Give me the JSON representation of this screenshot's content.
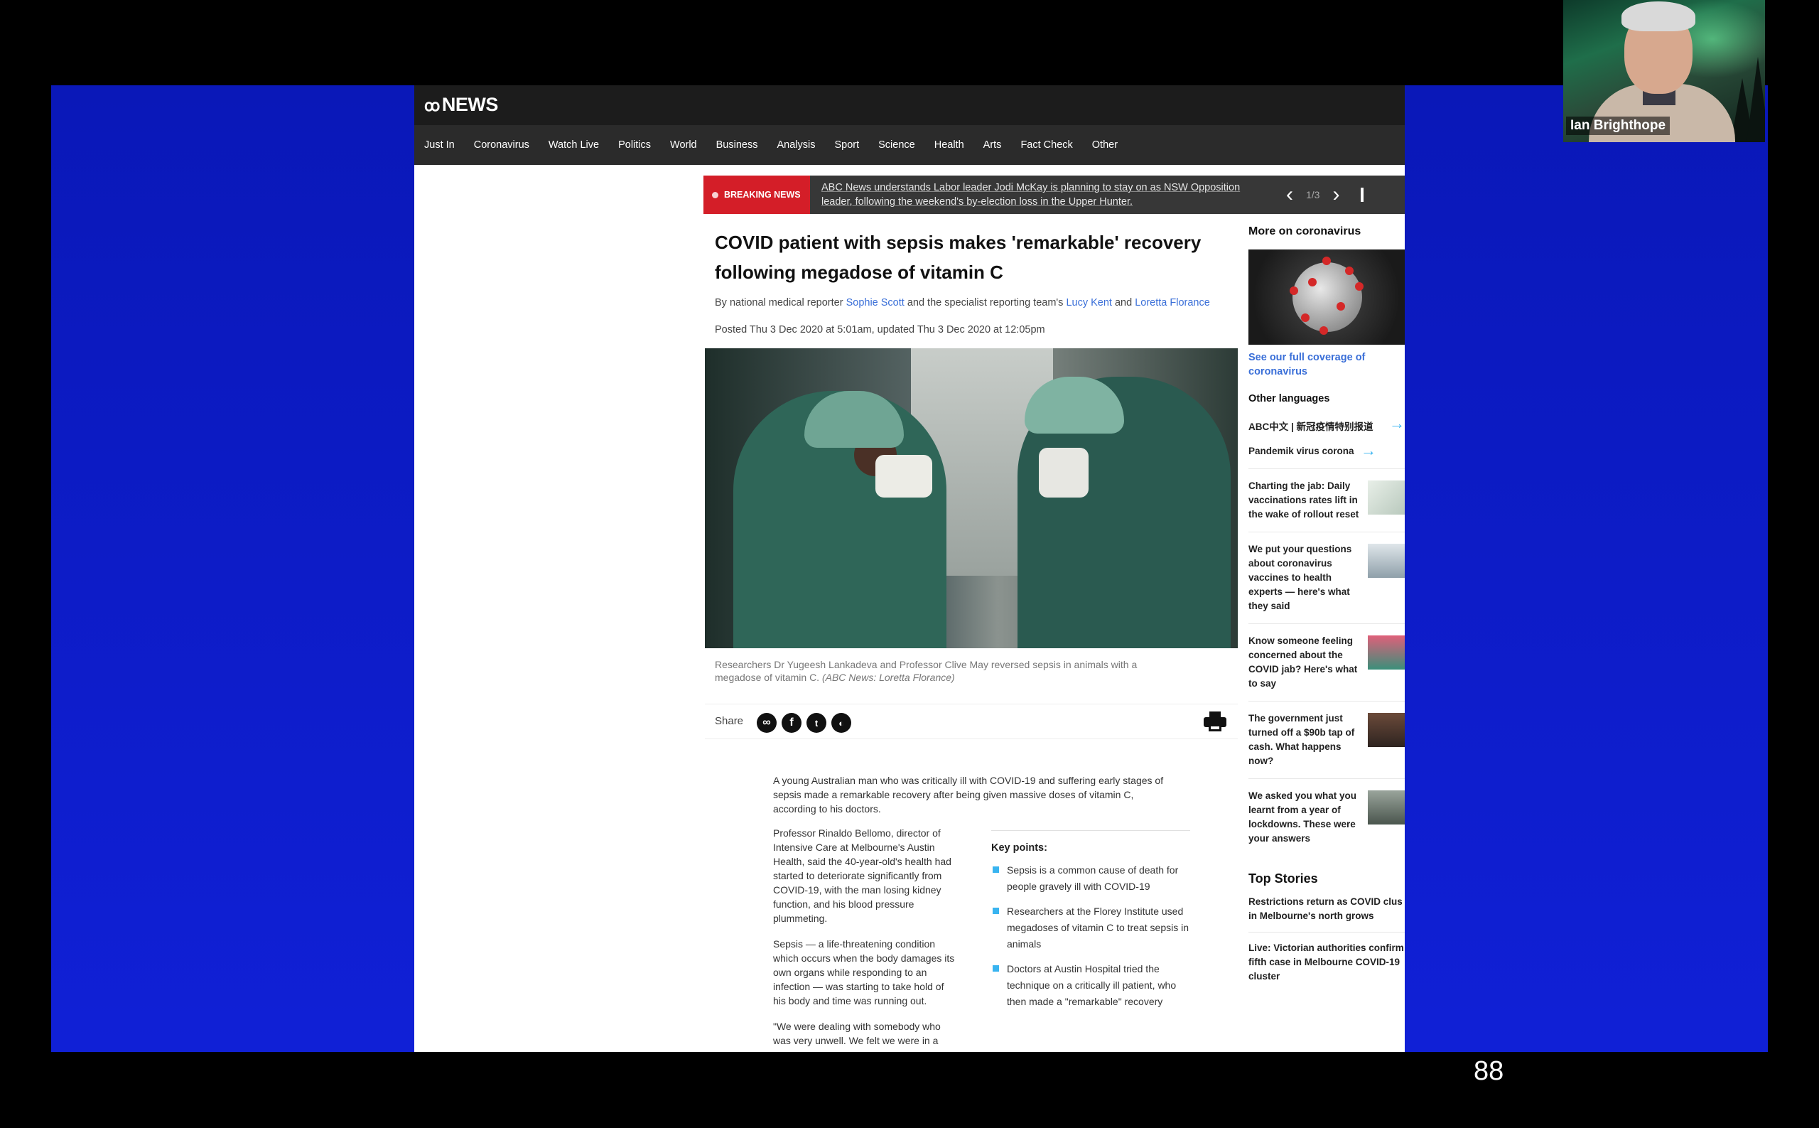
{
  "slide": {
    "number": "88"
  },
  "webcam": {
    "name": "Ian Brighthope"
  },
  "site": {
    "logo": "NEWS",
    "nav": [
      "Just In",
      "Coronavirus",
      "Watch Live",
      "Politics",
      "World",
      "Business",
      "Analysis",
      "Sport",
      "Science",
      "Health",
      "Arts",
      "Fact Check",
      "Other"
    ]
  },
  "breaking": {
    "badge": "BREAKING NEWS",
    "line1": "ABC News understands Labor leader Jodi McKay is planning to stay on as NSW Opposition",
    "line2": "leader, following the weekend's by-election loss in the Upper Hunter.",
    "counter": "1/3",
    "prev": "‹",
    "next": "›"
  },
  "article": {
    "headline_line1": "COVID patient with sepsis makes 'remarkable' recovery",
    "headline_line2": "following megadose of vitamin C",
    "byline_prefix": "By national medical reporter ",
    "byline_author1": "Sophie Scott",
    "byline_mid": " and the specialist reporting team's ",
    "byline_author2": "Lucy Kent",
    "byline_and": " and ",
    "byline_author3": "Loretta Florance",
    "posted": "Posted Thu 3 Dec 2020 at 5:01am, updated Thu 3 Dec 2020 at 12:05pm",
    "caption_line1": "Researchers Dr Yugeesh Lankadeva and Professor Clive May reversed sepsis in animals with a",
    "caption_line2": "megadose of vitamin C. ",
    "caption_credit": "(ABC News: Loretta Florance)",
    "share_label": "Share",
    "intro": "A young Australian man who was critically ill with COVID-19 and suffering early stages of sepsis made a remarkable recovery after being given massive doses of vitamin C, according to his doctors.",
    "para1": "Professor Rinaldo Bellomo, director of Intensive Care at Melbourne's Austin Health, said the 40-year-old's health had started to deteriorate significantly from COVID-19, with the man losing kidney function, and his blood pressure plummeting.",
    "para2": "Sepsis — a life-threatening condition which occurs when the body damages its own organs while responding to an infection — was starting to take hold of his body and time was running out.",
    "para3": "\"We were dealing with somebody who was very unwell. We felt we were in a very",
    "key_points_title": "Key points:",
    "key_points": [
      "Sepsis is a common cause of death for people gravely ill with COVID-19",
      "Researchers at the Florey Institute used megadoses of vitamin C to treat sepsis in animals",
      "Doctors at Austin Hospital tried the technique on a critically ill patient, who then made a \"remarkable\" recovery"
    ]
  },
  "sidebar": {
    "more_title": "More on coronavirus",
    "coverage_link": "See our full coverage of coronavirus",
    "other_languages_title": "Other languages",
    "languages": [
      "ABC中文 | 新冠疫情特别报道",
      "Pandemik virus corona"
    ],
    "stories": [
      "Charting the jab: Daily vaccinations rates lift in the wake of rollout reset",
      "We put your questions about coronavirus vaccines to health experts — here's what they said",
      "Know someone feeling concerned about the COVID jab? Here's what to say",
      "The government just turned off a $90b tap of cash. What happens now?",
      "We asked you what you learnt from a year of lockdowns. These were your answers"
    ],
    "top_stories_title": "Top Stories",
    "top_stories": [
      [
        "Restrictions return as COVID clus",
        "in Melbourne's north grows"
      ],
      [
        "Live: Victorian authorities confirm",
        "fifth case in Melbourne COVID-19",
        "cluster"
      ]
    ]
  }
}
